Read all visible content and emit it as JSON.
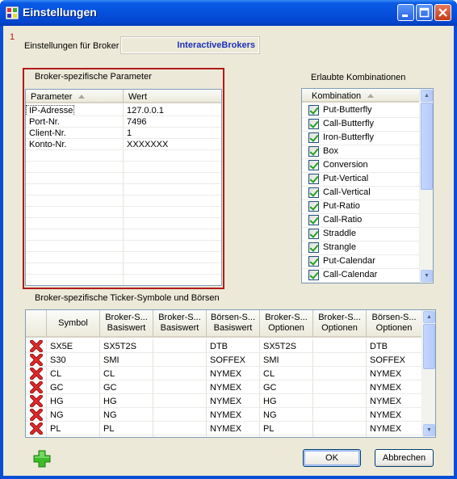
{
  "window": {
    "title": "Einstellungen"
  },
  "broker": {
    "marker": "1",
    "label": "Einstellungen für Broker",
    "value": "InteractiveBrokers"
  },
  "params": {
    "title": "Broker-spezifische Parameter",
    "columns": [
      "Parameter",
      "Wert"
    ],
    "rows": [
      [
        "IP-Adresse",
        "127.0.0.1"
      ],
      [
        "Port-Nr.",
        "7496"
      ],
      [
        "Client-Nr.",
        "1"
      ],
      [
        "Konto-Nr.",
        "XXXXXXX"
      ]
    ]
  },
  "combos": {
    "title": "Erlaubte Kombinationen",
    "column": "Kombination",
    "items": [
      "Put-Butterfly",
      "Call-Butterfly",
      "Iron-Butterfly",
      "Box",
      "Conversion",
      "Put-Vertical",
      "Call-Vertical",
      "Put-Ratio",
      "Call-Ratio",
      "Straddle",
      "Strangle",
      "Put-Calendar",
      "Call-Calendar"
    ]
  },
  "tickers": {
    "title": "Broker-spezifische Ticker-Symbole und Börsen",
    "columns": [
      "Symbol",
      "Broker-S...\nBasiswert",
      "Broker-S...\nBasiswert",
      "Börsen-S...\nBasiswert",
      "Broker-S...\nOptionen",
      "Broker-S...\nOptionen",
      "Börsen-S...\nOptionen"
    ],
    "rows": [
      [
        "SX5E",
        "SX5T2S",
        "",
        "DTB",
        "SX5T2S",
        "",
        "DTB"
      ],
      [
        "S30",
        "SMI",
        "",
        "SOFFEX",
        "SMI",
        "",
        "SOFFEX"
      ],
      [
        "CL",
        "CL",
        "",
        "NYMEX",
        "CL",
        "",
        "NYMEX"
      ],
      [
        "GC",
        "GC",
        "",
        "NYMEX",
        "GC",
        "",
        "NYMEX"
      ],
      [
        "HG",
        "HG",
        "",
        "NYMEX",
        "HG",
        "",
        "NYMEX"
      ],
      [
        "NG",
        "NG",
        "",
        "NYMEX",
        "NG",
        "",
        "NYMEX"
      ],
      [
        "PL",
        "PL",
        "",
        "NYMEX",
        "PL",
        "",
        "NYMEX"
      ]
    ]
  },
  "buttons": {
    "ok": "OK",
    "cancel": "Abbrechen"
  },
  "icons": {
    "app": "settings-app-icon",
    "delete": "red-x-icon",
    "add": "green-plus-icon"
  },
  "colors": {
    "titlebar": "#0550dc",
    "highlight_border": "#b21a1a",
    "broker_value": "#1c2fb8"
  }
}
